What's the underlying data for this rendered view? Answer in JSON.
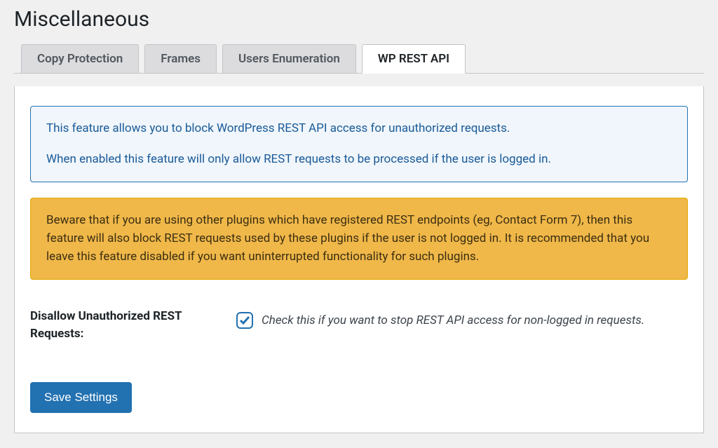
{
  "page_title": "Miscellaneous",
  "tabs": [
    {
      "label": "Copy Protection",
      "active": false
    },
    {
      "label": "Frames",
      "active": false
    },
    {
      "label": "Users Enumeration",
      "active": false
    },
    {
      "label": "WP REST API",
      "active": true
    }
  ],
  "info": {
    "line1": "This feature allows you to block WordPress REST API access for unauthorized requests.",
    "line2": "When enabled this feature will only allow REST requests to be processed if the user is logged in."
  },
  "warning": "Beware that if you are using other plugins which have registered REST endpoints (eg, Contact Form 7), then this feature will also block REST requests used by these plugins if the user is not logged in. It is recommended that you leave this feature disabled if you want uninterrupted functionality for such plugins.",
  "setting": {
    "label": "Disallow Unauthorized REST Requests:",
    "checked": true,
    "description": "Check this if you want to stop REST API access for non-logged in requests."
  },
  "save_button": "Save Settings"
}
